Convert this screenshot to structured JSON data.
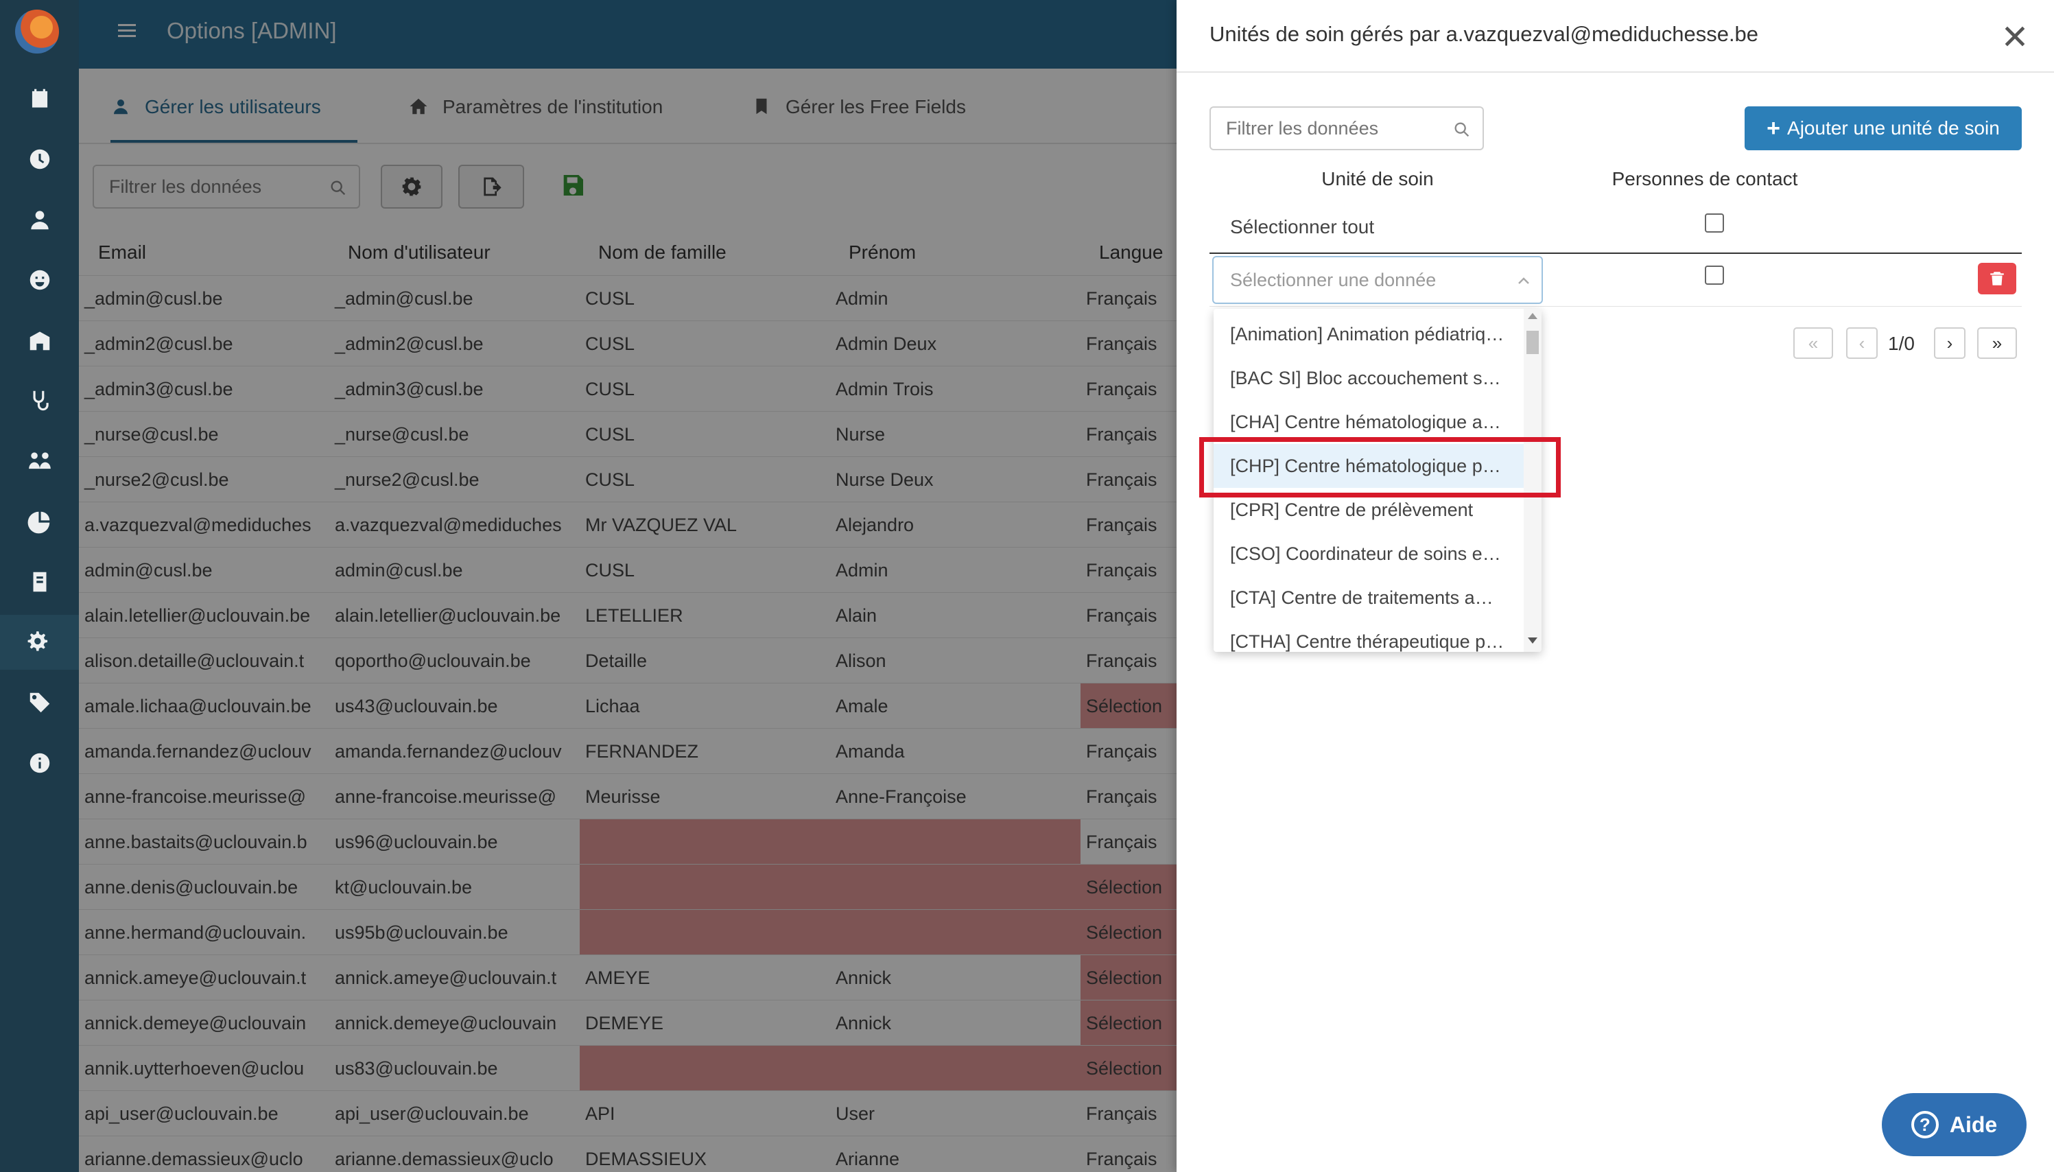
{
  "app": {
    "title": "Options [ADMIN]"
  },
  "nav_icons": [
    "calendar-icon",
    "clock-icon",
    "teacher-icon",
    "smiley-icon",
    "building-icon",
    "stethoscope-icon",
    "people-icon",
    "pie-chart-icon",
    "id-card-icon",
    "settings-icon",
    "tags-icon",
    "info-icon"
  ],
  "tabs": [
    {
      "label": "Gérer les utilisateurs",
      "icon": "user-icon",
      "active": true
    },
    {
      "label": "Paramètres de l'institution",
      "icon": "home-icon",
      "active": false
    },
    {
      "label": "Gérer les Free Fields",
      "icon": "bookmark-icon",
      "active": false
    }
  ],
  "toolbar": {
    "filter_placeholder": "Filtrer les données"
  },
  "table": {
    "columns": [
      "Email",
      "Nom d'utilisateur",
      "Nom de famille",
      "Prénom",
      "Langue"
    ],
    "rows": [
      [
        "_admin@cusl.be",
        "_admin@cusl.be",
        "CUSL",
        "Admin",
        "Français"
      ],
      [
        "_admin2@cusl.be",
        "_admin2@cusl.be",
        "CUSL",
        "Admin Deux",
        "Français"
      ],
      [
        "_admin3@cusl.be",
        "_admin3@cusl.be",
        "CUSL",
        "Admin Trois",
        "Français"
      ],
      [
        "_nurse@cusl.be",
        "_nurse@cusl.be",
        "CUSL",
        "Nurse",
        "Français"
      ],
      [
        "_nurse2@cusl.be",
        "_nurse2@cusl.be",
        "CUSL",
        "Nurse Deux",
        "Français"
      ],
      [
        "a.vazquezval@mediduches",
        "a.vazquezval@mediduches",
        "Mr VAZQUEZ VAL",
        "Alejandro",
        "Français"
      ],
      [
        "admin@cusl.be",
        "admin@cusl.be",
        "CUSL",
        "Admin",
        "Français"
      ],
      [
        "alain.letellier@uclouvain.be",
        "alain.letellier@uclouvain.be",
        "LETELLIER",
        "Alain",
        "Français"
      ],
      [
        "alison.detaille@uclouvain.t",
        "qoportho@uclouvain.be",
        "Detaille",
        "Alison",
        "Français"
      ],
      [
        "amale.lichaa@uclouvain.be",
        "us43@uclouvain.be",
        "Lichaa",
        "Amale",
        "Sélection"
      ],
      [
        "amanda.fernandez@uclouv",
        "amanda.fernandez@uclouv",
        "FERNANDEZ",
        "Amanda",
        "Français"
      ],
      [
        "anne-francoise.meurisse@",
        "anne-francoise.meurisse@",
        "Meurisse",
        "Anne-Françoise",
        "Français"
      ],
      [
        "anne.bastaits@uclouvain.b",
        "us96@uclouvain.be",
        "",
        "",
        "Français"
      ],
      [
        "anne.denis@uclouvain.be",
        "kt@uclouvain.be",
        "",
        "",
        "Sélection"
      ],
      [
        "anne.hermand@uclouvain.",
        "us95b@uclouvain.be",
        "",
        "",
        "Sélection"
      ],
      [
        "annick.ameye@uclouvain.t",
        "annick.ameye@uclouvain.t",
        "AMEYE",
        "Annick",
        "Sélection"
      ],
      [
        "annick.demeye@uclouvain",
        "annick.demeye@uclouvain",
        "DEMEYE",
        "Annick",
        "Sélection"
      ],
      [
        "annik.uytterhoeven@uclou",
        "us83@uclouvain.be",
        "",
        "",
        "Sélection"
      ],
      [
        "api_user@uclouvain.be",
        "api_user@uclouvain.be",
        "API",
        "User",
        "Français"
      ],
      [
        "arianne.demassieux@uclo",
        "arianne.demassieux@uclo",
        "DEMASSIEUX",
        "Arianne",
        "Français"
      ]
    ]
  },
  "drawer": {
    "title": "Unités de soin gérés par a.vazquezval@mediduchesse.be",
    "filter_placeholder": "Filtrer les données",
    "add_button": "Ajouter une unité de soin",
    "col_unit": "Unité de soin",
    "col_contact": "Personnes de contact",
    "select_all": "Sélectionner tout",
    "select_placeholder": "Sélectionner une donnée",
    "pagination": "1/0",
    "options": [
      "[Animation] Animation pédiatrique",
      "[BAC SI] Bloc accouchement soins intensifs",
      "[CHA] Centre hématologique adulte",
      "[CHP] Centre hématologique pédiatrique",
      "[CPR] Centre de prélèvement",
      "[CSO] Coordinateur de soins en oncologie",
      "[CTA] Centre de traitements ambulatoires",
      "[CTHA] Centre thérapeutique pédiatrique"
    ]
  },
  "help": {
    "label": "Aide"
  }
}
